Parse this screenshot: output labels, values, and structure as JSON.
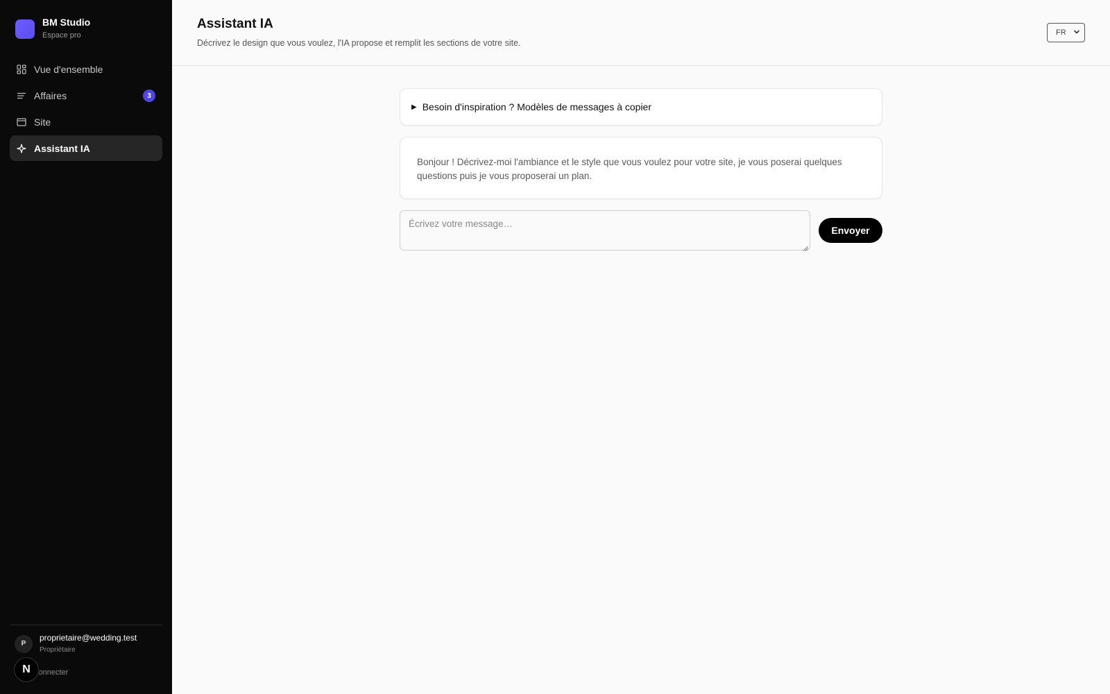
{
  "brand": {
    "name": "BM Studio",
    "subtitle": "Espace pro"
  },
  "sidebar": {
    "items": [
      {
        "label": "Vue d'ensemble",
        "icon": "grid-icon",
        "active": false
      },
      {
        "label": "Affaires",
        "icon": "list-icon",
        "active": false,
        "badge": "3"
      },
      {
        "label": "Site",
        "icon": "browser-window-icon",
        "active": false
      },
      {
        "label": "Assistant IA",
        "icon": "sparkle-icon",
        "active": true
      }
    ],
    "user": {
      "initial": "P",
      "email": "proprietaire@wedding.test",
      "role": "Propriétaire"
    },
    "logout_label": "connecter",
    "next_badge_letter": "N"
  },
  "header": {
    "title": "Assistant IA",
    "subtitle": "Décrivez le design que vous voulez, l'IA propose et remplit les sections de votre site.",
    "language": "FR"
  },
  "chat": {
    "inspiration_label": "Besoin d'inspiration ? Modèles de messages à copier",
    "assistant_message": "Bonjour ! Décrivez-moi l'ambiance et le style que vous voulez pour votre site, je vous poserai quelques questions puis je vous proposerai un plan.",
    "input_placeholder": "Écrivez votre message…",
    "send_label": "Envoyer"
  },
  "colors": {
    "sidebar_bg": "#0a0a0a",
    "accent": "#4f46e5",
    "brand_logo": "#6d5cff"
  }
}
